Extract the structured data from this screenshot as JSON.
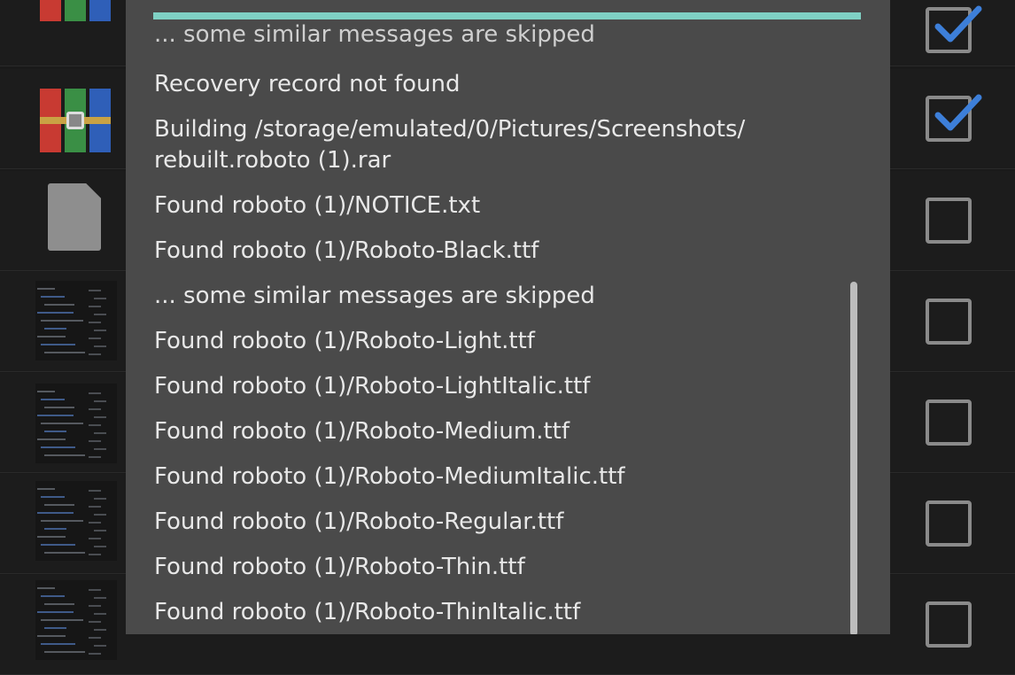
{
  "file_list": {
    "rows": [
      {
        "icon": "rar-archive-icon",
        "checked": true
      },
      {
        "icon": "rar-archive-icon",
        "checked": true
      },
      {
        "icon": "document-icon",
        "checked": false
      },
      {
        "icon": "screenshot-thumbnail",
        "checked": false
      },
      {
        "icon": "screenshot-thumbnail",
        "checked": false
      },
      {
        "icon": "screenshot-thumbnail",
        "checked": false
      },
      {
        "icon": "screenshot-thumbnail",
        "checked": false
      }
    ]
  },
  "dialog": {
    "progress": 1.0,
    "log_lines": [
      "... some similar messages are skipped",
      "Recovery record not found",
      "Building /storage/emulated/0/Pictures/Screenshots/",
      "rebuilt.roboto (1).rar",
      "Found roboto (1)/NOTICE.txt",
      "Found roboto (1)/Roboto-Black.ttf",
      "... some similar messages are skipped",
      "Found roboto (1)/Roboto-Light.ttf",
      "Found roboto (1)/Roboto-LightItalic.ttf",
      "Found roboto (1)/Roboto-Medium.ttf",
      "Found roboto (1)/Roboto-MediumItalic.ttf",
      "Found roboto (1)/Roboto-Regular.ttf",
      "Found roboto (1)/Roboto-Thin.ttf",
      "Found roboto (1)/Roboto-ThinItalic.ttf"
    ]
  },
  "colors": {
    "progress": "#7fd1c4",
    "dialog_bg": "#4a4a4a",
    "check_accent": "#3d7fd9"
  }
}
